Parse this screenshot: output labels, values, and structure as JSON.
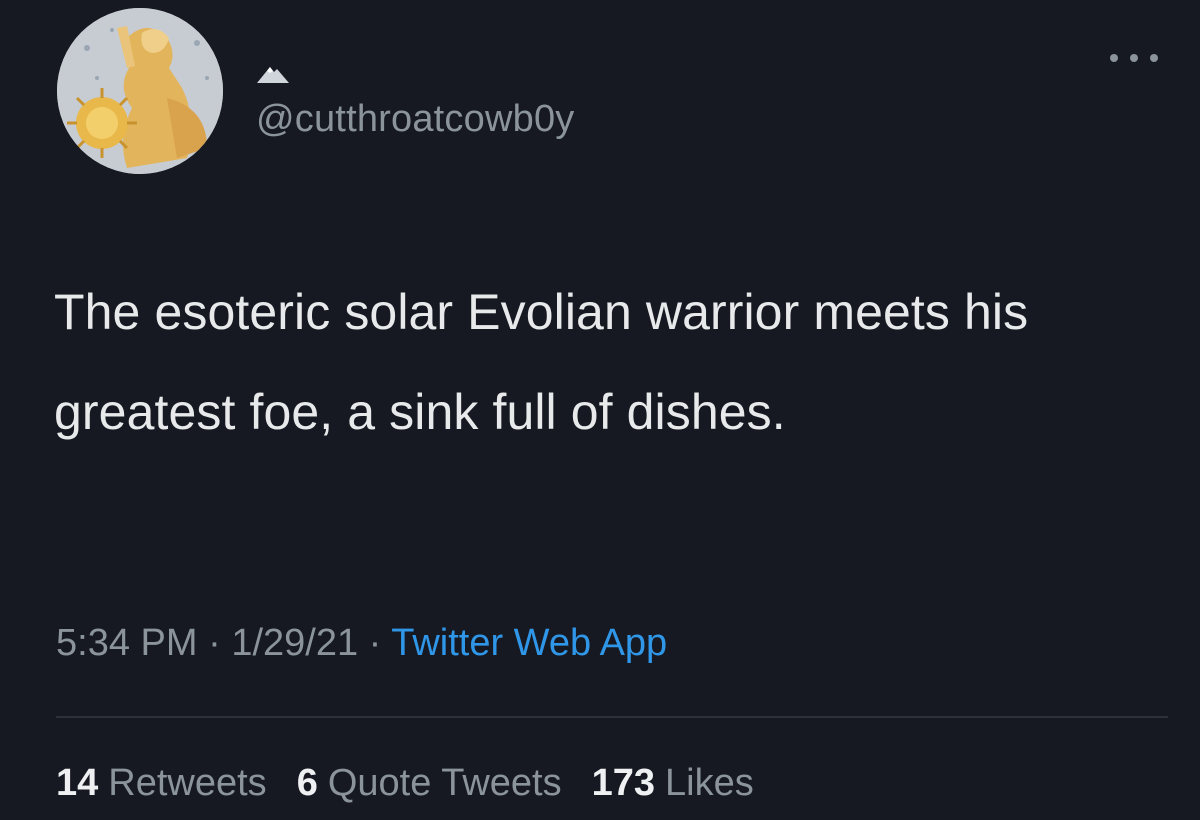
{
  "tweet": {
    "display_name_icon": "mountain-icon",
    "handle": "@cutthroatcowb0y",
    "body": "The esoteric solar Evolian warrior meets his greatest foe, a sink full of dishes.",
    "time": "5:34 PM",
    "separator": "·",
    "date": "1/29/21",
    "source": "Twitter Web App",
    "more_icon": "more-horizontal-icon"
  },
  "stats": {
    "retweets_count": "14",
    "retweets_label": "Retweets",
    "quotes_count": "6",
    "quotes_label": "Quote Tweets",
    "likes_count": "173",
    "likes_label": "Likes"
  },
  "colors": {
    "background": "#161922",
    "text": "#e7e9ea",
    "muted": "#8b939b",
    "link": "#2f96e8"
  }
}
